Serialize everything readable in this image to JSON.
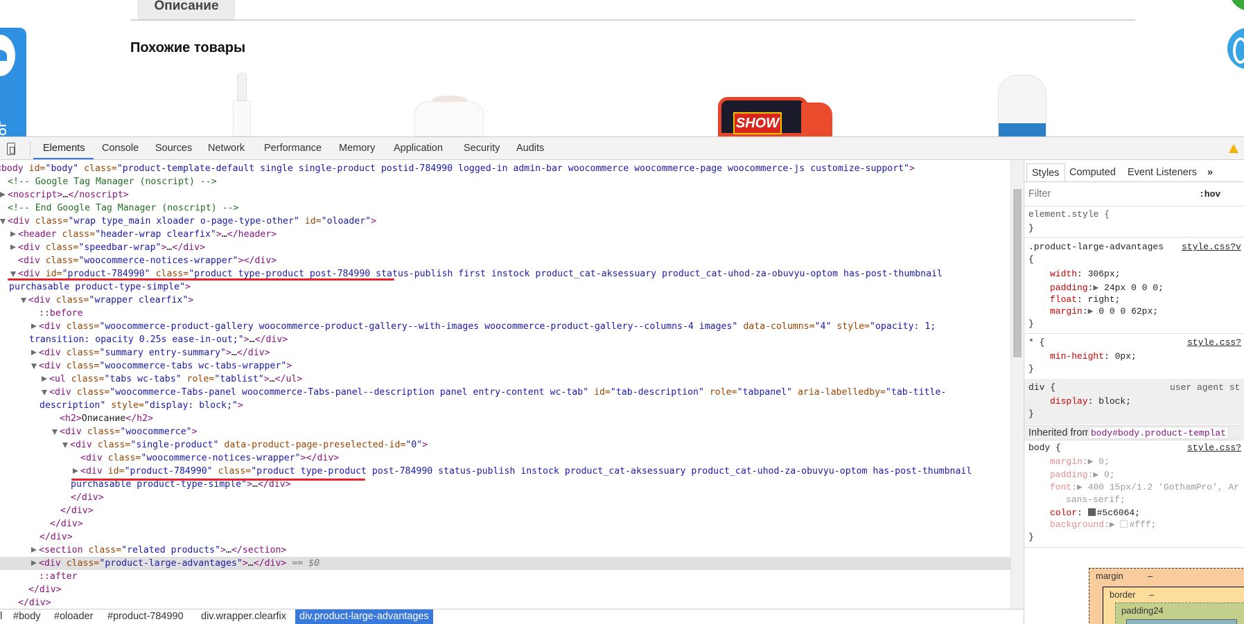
{
  "page": {
    "description_tab": "Описание",
    "related_title": "Похожие товары",
    "side_tab_label": "КАТАЛОГ",
    "product_label": "SHOW"
  },
  "toolbar": {
    "tabs": [
      "Elements",
      "Console",
      "Sources",
      "Network",
      "Performance",
      "Memory",
      "Application",
      "Security",
      "Audits"
    ],
    "active_tab": "Elements",
    "icons": {
      "device": "device-mode-icon",
      "warning": "warning-icon"
    },
    "accent": "#3879d9"
  },
  "dom": {
    "lines": [
      {
        "text": "<body id=\"body\" class=\"product-template-default single single-product postid-784990 logged-in admin-bar woocommerce woocommerce-page woocommerce-js customize-support\">",
        "toggle": ""
      },
      {
        "text": "<!-- Google Tag Manager (noscript) -->",
        "toggle": ""
      },
      {
        "text": "<noscript>…</noscript>",
        "toggle": "closed"
      },
      {
        "text": "<!-- End Google Tag Manager (noscript) -->",
        "toggle": ""
      },
      {
        "text": "<div class=\"wrap type_main xloader o-page-type-other\" id=\"oloader\">",
        "toggle": "open"
      },
      {
        "text": "<header class=\"header-wrap clearfix\">…</header>",
        "toggle": "closed"
      },
      {
        "text": "<div class=\"speedbar-wrap\">…</div>",
        "toggle": "closed"
      },
      {
        "text": "<div class=\"woocommerce-notices-wrapper\"></div>",
        "toggle": ""
      },
      {
        "text": "<div id=\"product-784990\" class=\"product type-product post-784990 status-publish first instock product_cat-aksessuary product_cat-uhod-za-obuvyu-optom has-post-thumbnail",
        "toggle": "open"
      },
      {
        "text": "purchasable product-type-simple\">",
        "toggle": ""
      },
      {
        "text": "<div class=\"wrapper clearfix\">",
        "toggle": "open"
      },
      {
        "text": "::before",
        "toggle": ""
      },
      {
        "text": "<div class=\"woocommerce-product-gallery woocommerce-product-gallery--with-images woocommerce-product-gallery--columns-4 images\" data-columns=\"4\" style=\"opacity: 1;",
        "toggle": "closed"
      },
      {
        "text": "transition: opacity 0.25s ease-in-out;\">…</div>",
        "toggle": ""
      },
      {
        "text": "<div class=\"summary entry-summary\">…</div>",
        "toggle": "closed"
      },
      {
        "text": "<div class=\"woocommerce-tabs wc-tabs-wrapper\">",
        "toggle": "open"
      },
      {
        "text": "<ul class=\"tabs wc-tabs\" role=\"tablist\">…</ul>",
        "toggle": "closed"
      },
      {
        "text": "<div class=\"woocommerce-Tabs-panel woocommerce-Tabs-panel--description panel entry-content wc-tab\" id=\"tab-description\" role=\"tabpanel\" aria-labelledby=\"tab-title-",
        "toggle": "open"
      },
      {
        "text": "description\" style=\"display: block;\">",
        "toggle": ""
      },
      {
        "text": "<h2>Описание</h2>",
        "toggle": ""
      },
      {
        "text": "<div class=\"woocommerce\">",
        "toggle": "open"
      },
      {
        "text": "<div class=\"single-product\" data-product-page-preselected-id=\"0\">",
        "toggle": "open"
      },
      {
        "text": "<div class=\"woocommerce-notices-wrapper\"></div>",
        "toggle": ""
      },
      {
        "text": "<div id=\"product-784990\" class=\"product type-product post-784990 status-publish instock product_cat-aksessuary product_cat-uhod-za-obuvyu-optom has-post-thumbnail",
        "toggle": "closed"
      },
      {
        "text": "purchasable product-type-simple\">…</div>",
        "toggle": ""
      },
      {
        "text": "</div>",
        "toggle": ""
      },
      {
        "text": "</div>",
        "toggle": ""
      },
      {
        "text": "</div>",
        "toggle": ""
      },
      {
        "text": "</div>",
        "toggle": ""
      },
      {
        "text": "<section class=\"related products\">…</section>",
        "toggle": "closed"
      },
      {
        "text": "<div class=\"product-large-advantages\">…</div> == $0",
        "toggle": "closed",
        "selected": true
      },
      {
        "text": "::after",
        "toggle": ""
      },
      {
        "text": "</div>",
        "toggle": ""
      },
      {
        "text": "</div>",
        "toggle": ""
      }
    ],
    "annotation_color": "#e8212a"
  },
  "breadcrumbs": {
    "items": [
      "l",
      "#body",
      "#oloader",
      "#product-784990",
      "div.wrapper.clearfix",
      "div.product-large-advantages"
    ],
    "selected": "div.product-large-advantages"
  },
  "sidebar": {
    "tabs": [
      "Styles",
      "Computed",
      "Event Listeners"
    ],
    "more": "»",
    "active_tab": "Styles",
    "filter_placeholder": "Filter",
    "hov": ":hov",
    "element_style": "element.style {",
    "close": "}",
    "open": "{",
    "rule1": {
      "selector": ".product-large-advantages",
      "source": "style.css?v",
      "props": [
        {
          "name": "width",
          "value": "306px;"
        },
        {
          "name": "padding",
          "value": "24px 0 0 0;"
        },
        {
          "name": "float",
          "value": "right;"
        },
        {
          "name": "margin",
          "value": "0 0 0 62px;"
        }
      ]
    },
    "rule2": {
      "selector": "* {",
      "source": "style.css?",
      "prop": "min-height",
      "value": "0px;"
    },
    "rule3": {
      "selector": "div {",
      "source": "user agent st",
      "prop": "display",
      "value": "block;"
    },
    "inherited_label": "Inherited from",
    "inherited_from": "body#body.product-templat",
    "rule4": {
      "selector": "body {",
      "source": "style.css?",
      "margin": "0;",
      "padding": "0;",
      "font": "400 15px/1.2 'GothamPro', Ar",
      "font_cont": "sans-serif;",
      "color": "#5c6064;",
      "background": "#fff;"
    },
    "colors": {
      "body_color": "#5c6064",
      "body_background": "#fff"
    },
    "box_model": {
      "margin": "margin",
      "margin_val": "–",
      "border": "border",
      "border_val": "–",
      "padding": "padding",
      "padding_val": "24"
    }
  }
}
